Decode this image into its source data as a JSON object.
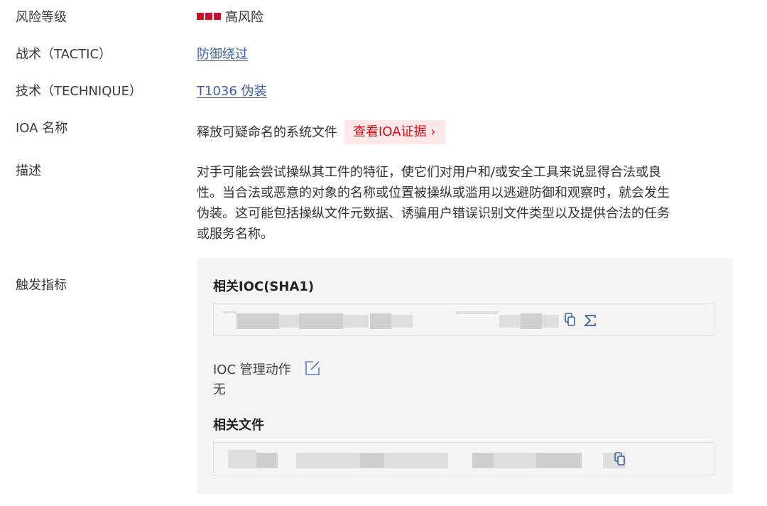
{
  "rows": {
    "risk": {
      "label": "风险等级",
      "value": "高风险",
      "color": "#c8102e"
    },
    "tactic": {
      "label": "战术（TACTIC）",
      "value": "防御绕过"
    },
    "technique": {
      "label": "技术（TECHNIQUE）",
      "value": "T1036 伪装"
    },
    "ioa": {
      "label": "IOA 名称",
      "value": "释放可疑命名的系统文件",
      "button": "查看IOA证据",
      "button_chevron": "›"
    },
    "desc": {
      "label": "描述",
      "lines": [
        "对手可能会尝试操纵其工件的特征，使它们对用户和/或安全工具来说显得合法或良",
        "性。当合法或恶意的对象的名称或位置被操纵或滥用以逃避防御和观察时，就会发生",
        "伪装。这可能包括操纵文件元数据、诱骗用户错误识别文件类型以及提供合法的任务",
        "或服务名称。"
      ]
    },
    "trigger": {
      "label": "触发指标"
    }
  },
  "panel": {
    "ioc_title": "相关IOC(SHA1)",
    "ioc_action_label": "IOC 管理动作",
    "ioc_action_value": "无",
    "files_title": "相关文件"
  },
  "icons": {
    "copy": "copy-icon",
    "sigma": "sigma-icon",
    "edit": "edit-icon"
  },
  "colors": {
    "link": "#3b5ea6",
    "danger": "#d4101f",
    "danger_bg": "#fde8e9"
  }
}
